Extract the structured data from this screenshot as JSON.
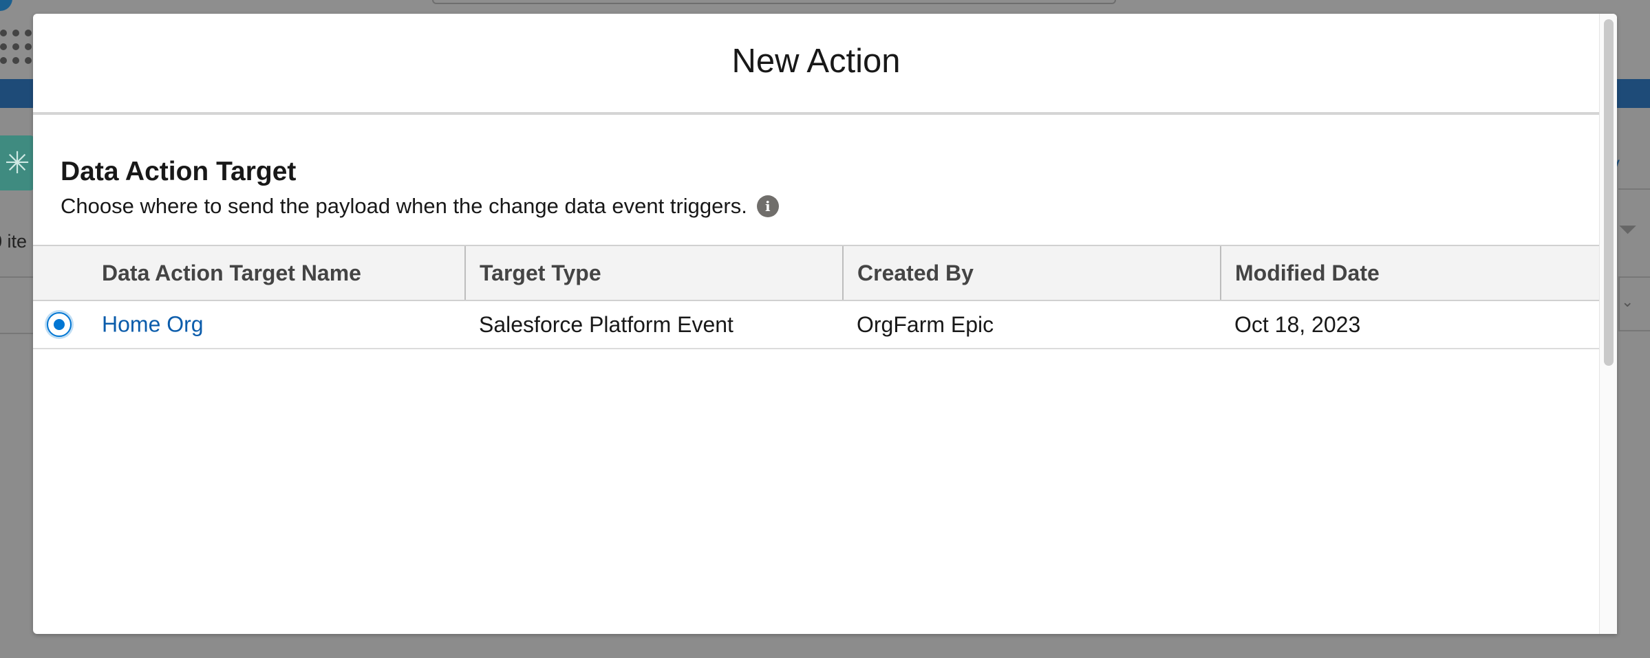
{
  "background": {
    "items_text": "0 ite",
    "right_link_text": "v"
  },
  "modal": {
    "title": "New Action",
    "section_title": "Data Action Target",
    "section_description": "Choose where to send the payload when the change data event triggers.",
    "info_icon": "info-icon"
  },
  "table": {
    "columns": [
      {
        "label": "Data Action Target Name"
      },
      {
        "label": "Target Type"
      },
      {
        "label": "Created By"
      },
      {
        "label": "Modified Date"
      }
    ],
    "rows": [
      {
        "selected": true,
        "name": "Home Org",
        "target_type": "Salesforce Platform Event",
        "created_by": "OrgFarm Epic",
        "modified_date": "Oct 18, 2023"
      }
    ]
  },
  "colors": {
    "accent": "#0176d3",
    "link": "#0b5cab",
    "header_band": "#1e4b78"
  }
}
